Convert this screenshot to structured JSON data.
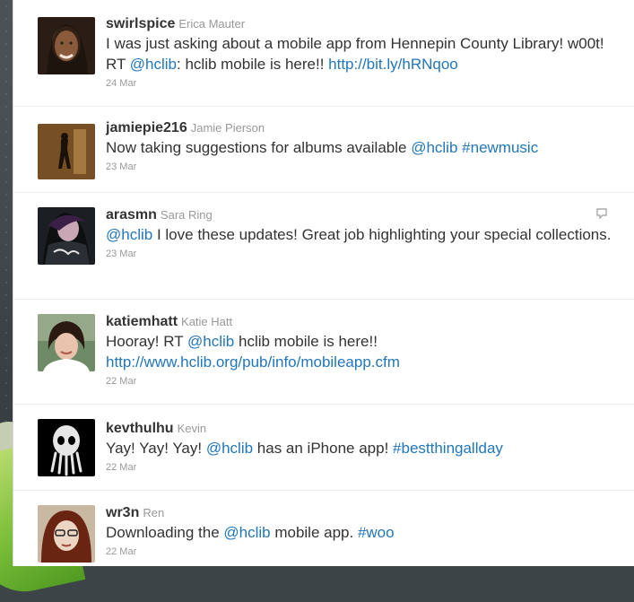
{
  "tweets": [
    {
      "screen_name": "swirlspice",
      "full_name": "Erica Mauter",
      "segments": [
        {
          "text": "I was just asking about a mobile app from Hennepin County Library! w00t! RT "
        },
        {
          "text": "@hclib",
          "link": true
        },
        {
          "text": ": hclib mobile is here!! "
        },
        {
          "text": "http://bit.ly/hRNqoo",
          "link": true
        }
      ],
      "timestamp": "24 Mar",
      "avatar": "avatar-erica"
    },
    {
      "screen_name": "jamiepie216",
      "full_name": "Jamie Pierson",
      "segments": [
        {
          "text": "Now taking suggestions for albums available "
        },
        {
          "text": "@hclib",
          "link": true
        },
        {
          "text": " "
        },
        {
          "text": "#newmusic",
          "link": true
        }
      ],
      "timestamp": "23 Mar",
      "avatar": "avatar-jamie"
    },
    {
      "screen_name": "arasmn",
      "full_name": "Sara Ring",
      "segments": [
        {
          "text": "@hclib",
          "link": true
        },
        {
          "text": " I love these updates! Great job highlighting your special collections."
        }
      ],
      "timestamp": "23 Mar",
      "avatar": "avatar-sara",
      "has_reply_icon": true
    },
    {
      "screen_name": "katiemhatt",
      "full_name": "Katie Hatt",
      "segments": [
        {
          "text": "Hooray! RT "
        },
        {
          "text": "@hclib",
          "link": true
        },
        {
          "text": " hclib mobile is here!! "
        },
        {
          "text": "http://www.hclib.org/pub/info/mobileapp.cfm",
          "link": true
        }
      ],
      "timestamp": "22 Mar",
      "avatar": "avatar-katie"
    },
    {
      "screen_name": "kevthulhu",
      "full_name": "Kevin",
      "segments": [
        {
          "text": "Yay! Yay! Yay! "
        },
        {
          "text": "@hclib",
          "link": true
        },
        {
          "text": " has an iPhone app! "
        },
        {
          "text": "#bestthingallday",
          "link": true
        }
      ],
      "timestamp": "22 Mar",
      "avatar": "avatar-kevin"
    },
    {
      "screen_name": "wr3n",
      "full_name": "Ren",
      "segments": [
        {
          "text": "Downloading the "
        },
        {
          "text": "@hclib",
          "link": true
        },
        {
          "text": " mobile app. "
        },
        {
          "text": "#woo",
          "link": true
        }
      ],
      "timestamp": "22 Mar",
      "avatar": "avatar-ren"
    }
  ],
  "colors": {
    "link": "#2276bb",
    "name": "#333333",
    "meta": "#999999"
  }
}
